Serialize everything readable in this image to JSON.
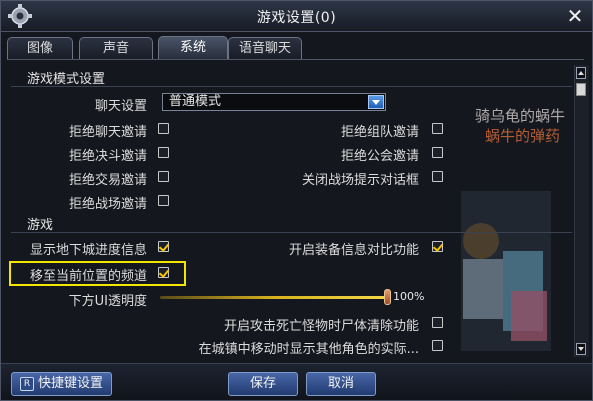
{
  "window": {
    "title": "游戏设置(0)"
  },
  "tabs": [
    {
      "label": "图像",
      "active": false
    },
    {
      "label": "声音",
      "active": false
    },
    {
      "label": "系统",
      "active": true
    },
    {
      "label": "语音聊天",
      "active": false
    }
  ],
  "background_text": {
    "line1": "骑乌龟的蜗牛",
    "line2": "蜗牛的弹药"
  },
  "sections": {
    "mode": {
      "title": "游戏模式设置",
      "chat_label": "聊天设置",
      "chat_value": "普通模式",
      "options_left": [
        {
          "label": "拒绝聊天邀请",
          "checked": false
        },
        {
          "label": "拒绝决斗邀请",
          "checked": false
        },
        {
          "label": "拒绝交易邀请",
          "checked": false
        },
        {
          "label": "拒绝战场邀请",
          "checked": false
        }
      ],
      "options_right": [
        {
          "label": "拒绝组队邀请",
          "checked": false
        },
        {
          "label": "拒绝公会邀请",
          "checked": false
        },
        {
          "label": "关闭战场提示对话框",
          "checked": false
        }
      ]
    },
    "game": {
      "title": "游戏",
      "dungeon_progress": {
        "label": "显示地下城进度信息",
        "checked": true
      },
      "equip_compare": {
        "label": "开启装备信息对比功能",
        "checked": true
      },
      "move_channel": {
        "label": "移至当前位置的频道",
        "checked": true
      },
      "ui_opacity": {
        "label": "下方UI透明度",
        "value_text": "100%",
        "value": 1.0
      },
      "corpse_clear": {
        "label": "开启攻击死亡怪物时尸体清除功能",
        "checked": false
      },
      "town_display": {
        "label": "在城镇中移动时显示其他角色的实际...",
        "checked": false
      }
    }
  },
  "footer": {
    "shortcut_label": "快捷键设置",
    "shortcut_icon_text": "R",
    "save_label": "保存",
    "cancel_label": "取消"
  },
  "colors": {
    "accent": "#f6c400",
    "highlight": "#f2e600",
    "button": "#3a5a9e"
  }
}
